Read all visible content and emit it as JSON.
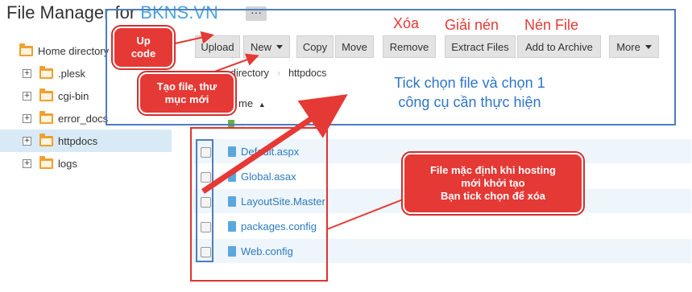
{
  "header": {
    "title": "File Manager for ",
    "domain": "BKNS.VN",
    "menu_label": "···"
  },
  "sidebar": {
    "items": [
      {
        "label": "Home directory",
        "toggle": ""
      },
      {
        "label": ".plesk",
        "toggle": "+"
      },
      {
        "label": "cgi-bin",
        "toggle": "+"
      },
      {
        "label": "error_docs",
        "toggle": "+"
      },
      {
        "label": "httpdocs",
        "toggle": "+"
      },
      {
        "label": "logs",
        "toggle": "+"
      }
    ]
  },
  "toolbar": {
    "upload": "Upload",
    "new": "New",
    "copy": "Copy",
    "move": "Move",
    "remove": "Remove",
    "extract": "Extract Files",
    "archive": "Add to Archive",
    "more": "More"
  },
  "breadcrumb": [
    "directory",
    "httpdocs"
  ],
  "list": {
    "name_header": "me",
    "sort_glyph": "▲",
    "parent_row": ".",
    "files": [
      "Default.aspx",
      "Global.asax",
      "LayoutSite.Master",
      "packages.config",
      "Web.config"
    ]
  },
  "annotations": {
    "upload_code": "Up\ncode",
    "create_file": "Tạo file, thư\nmục mới",
    "delete": "Xóa",
    "extract": "Giải nén",
    "compress": "Nén File",
    "tick_hint_1": "Tick chọn file và chọn 1",
    "tick_hint_2": "công cụ cần thực hiện",
    "default_files": "File mặc định khi hosting\nmới khởi tạo\nBạn tick chọn để xóa"
  },
  "colors": {
    "accent": "#4aa3df",
    "annotation_red": "#e53935",
    "annotation_blue": "#4f7cc0"
  }
}
